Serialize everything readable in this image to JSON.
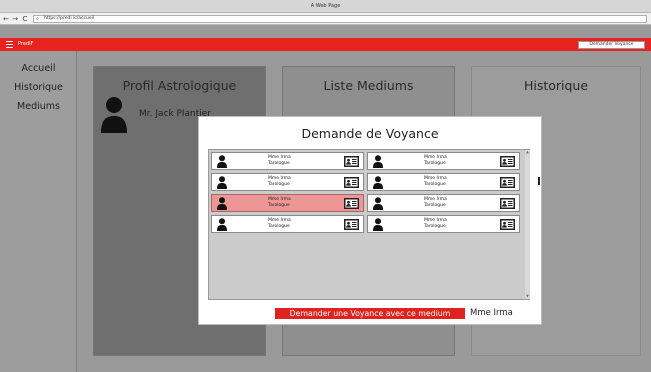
{
  "window": {
    "title": "A Web Page"
  },
  "browser": {
    "back": "←",
    "forward": "→",
    "reload": "C",
    "url": "https://predi ic/accueil"
  },
  "app": {
    "name": "PredIF",
    "demander_button": "Demander Voyance"
  },
  "sidebar": {
    "items": [
      {
        "label": "Accueil"
      },
      {
        "label": "Historique"
      },
      {
        "label": "Mediums"
      }
    ]
  },
  "panels": {
    "profil": {
      "title": "Profil Astrologique",
      "user_name": "Mr. Jack Plantier"
    },
    "liste": {
      "title": "Liste Mediums"
    },
    "historique": {
      "title": "Historique"
    }
  },
  "modal": {
    "title": "Demande de Voyance",
    "mediums": [
      {
        "name": "Mme Irma",
        "specialty": "Tarologue",
        "selected": false
      },
      {
        "name": "Mme Irma",
        "specialty": "Tarologue",
        "selected": false
      },
      {
        "name": "Mme Irma",
        "specialty": "Tarologue",
        "selected": false
      },
      {
        "name": "Mme Irma",
        "specialty": "Tarologue",
        "selected": false
      },
      {
        "name": "Mme Irma",
        "specialty": "Tarologue",
        "selected": true
      },
      {
        "name": "Mme Irma",
        "specialty": "Tarologue",
        "selected": false
      },
      {
        "name": "Mme Irma",
        "specialty": "Tarologue",
        "selected": false
      },
      {
        "name": "Mme Irma",
        "specialty": "Tarologue",
        "selected": false
      }
    ],
    "cta_label": "Demander une Voyance avec ce medium",
    "selected_medium": "Mme Irma"
  },
  "colors": {
    "accent": "#e8231f",
    "selected_row": "#ec9796"
  }
}
